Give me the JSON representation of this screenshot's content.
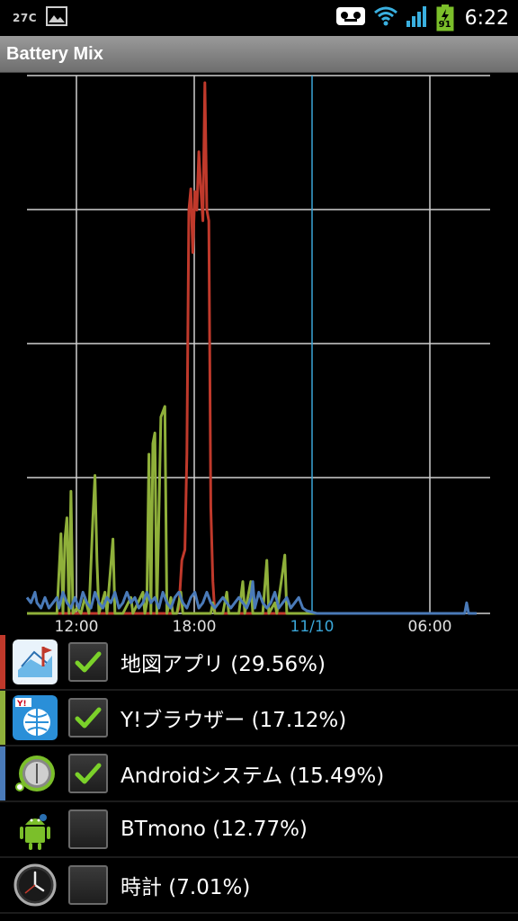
{
  "status_bar": {
    "temperature": "27C",
    "time": "6:22",
    "battery_level": "91",
    "icons": [
      "image-icon",
      "voicemail-icon",
      "wifi-icon",
      "signal-icon",
      "battery-icon"
    ]
  },
  "app_title": "Battery Mix",
  "chart_data": {
    "type": "line",
    "x_tick_labels": [
      "12:00",
      "18:00",
      "11/10",
      "06:00"
    ],
    "highlighted_tick": "11/10",
    "grid": true,
    "series": [
      {
        "name": "地図アプリ",
        "color": "#c0392b",
        "values": [
          [
            0,
            0
          ],
          [
            150,
            0
          ],
          [
            152,
            10
          ],
          [
            155,
            100
          ],
          [
            158,
            120
          ],
          [
            160,
            300
          ],
          [
            162,
            760
          ],
          [
            164,
            800
          ],
          [
            166,
            680
          ],
          [
            168,
            795
          ],
          [
            170,
            760
          ],
          [
            172,
            870
          ],
          [
            174,
            800
          ],
          [
            176,
            740
          ],
          [
            178,
            1000
          ],
          [
            180,
            760
          ],
          [
            182,
            740
          ],
          [
            184,
            200
          ],
          [
            186,
            60
          ],
          [
            188,
            0
          ],
          [
            290,
            0
          ]
        ]
      },
      {
        "name": "Y!ブラウザー",
        "color": "#8fb03a",
        "values": [
          [
            0,
            0
          ],
          [
            30,
            0
          ],
          [
            34,
            150
          ],
          [
            36,
            0
          ],
          [
            38,
            140
          ],
          [
            40,
            180
          ],
          [
            42,
            0
          ],
          [
            44,
            230
          ],
          [
            46,
            0
          ],
          [
            50,
            10
          ],
          [
            54,
            0
          ],
          [
            58,
            30
          ],
          [
            62,
            0
          ],
          [
            66,
            180
          ],
          [
            68,
            260
          ],
          [
            70,
            100
          ],
          [
            72,
            0
          ],
          [
            78,
            40
          ],
          [
            80,
            0
          ],
          [
            86,
            140
          ],
          [
            88,
            0
          ],
          [
            96,
            0
          ],
          [
            104,
            30
          ],
          [
            106,
            0
          ],
          [
            116,
            40
          ],
          [
            118,
            0
          ],
          [
            120,
            20
          ],
          [
            122,
            300
          ],
          [
            124,
            0
          ],
          [
            126,
            320
          ],
          [
            128,
            340
          ],
          [
            130,
            0
          ],
          [
            134,
            370
          ],
          [
            136,
            380
          ],
          [
            138,
            390
          ],
          [
            140,
            0
          ],
          [
            144,
            30
          ],
          [
            146,
            0
          ],
          [
            150,
            0
          ],
          [
            154,
            40
          ],
          [
            156,
            0
          ],
          [
            184,
            0
          ],
          [
            186,
            20
          ],
          [
            188,
            0
          ],
          [
            196,
            0
          ],
          [
            200,
            40
          ],
          [
            202,
            0
          ],
          [
            212,
            0
          ],
          [
            216,
            60
          ],
          [
            218,
            0
          ],
          [
            224,
            60
          ],
          [
            226,
            0
          ],
          [
            236,
            0
          ],
          [
            240,
            100
          ],
          [
            242,
            0
          ],
          [
            248,
            20
          ],
          [
            250,
            0
          ],
          [
            256,
            80
          ],
          [
            258,
            110
          ],
          [
            260,
            0
          ],
          [
            270,
            0
          ],
          [
            290,
            0
          ]
        ]
      },
      {
        "name": "Androidシステム",
        "color": "#4a7ab8",
        "values": [
          [
            0,
            30
          ],
          [
            4,
            20
          ],
          [
            8,
            40
          ],
          [
            10,
            20
          ],
          [
            14,
            10
          ],
          [
            18,
            30
          ],
          [
            22,
            10
          ],
          [
            26,
            20
          ],
          [
            30,
            30
          ],
          [
            32,
            10
          ],
          [
            36,
            40
          ],
          [
            40,
            20
          ],
          [
            44,
            10
          ],
          [
            48,
            30
          ],
          [
            52,
            10
          ],
          [
            56,
            40
          ],
          [
            60,
            20
          ],
          [
            64,
            10
          ],
          [
            68,
            40
          ],
          [
            72,
            20
          ],
          [
            76,
            10
          ],
          [
            80,
            30
          ],
          [
            84,
            20
          ],
          [
            88,
            40
          ],
          [
            92,
            10
          ],
          [
            96,
            20
          ],
          [
            100,
            40
          ],
          [
            104,
            20
          ],
          [
            108,
            30
          ],
          [
            112,
            10
          ],
          [
            116,
            20
          ],
          [
            120,
            40
          ],
          [
            124,
            20
          ],
          [
            128,
            30
          ],
          [
            132,
            10
          ],
          [
            136,
            40
          ],
          [
            140,
            20
          ],
          [
            144,
            10
          ],
          [
            148,
            30
          ],
          [
            152,
            40
          ],
          [
            156,
            20
          ],
          [
            160,
            10
          ],
          [
            164,
            30
          ],
          [
            168,
            40
          ],
          [
            172,
            10
          ],
          [
            176,
            20
          ],
          [
            180,
            40
          ],
          [
            184,
            20
          ],
          [
            188,
            10
          ],
          [
            192,
            20
          ],
          [
            196,
            30
          ],
          [
            200,
            20
          ],
          [
            204,
            10
          ],
          [
            208,
            20
          ],
          [
            212,
            30
          ],
          [
            216,
            20
          ],
          [
            220,
            10
          ],
          [
            224,
            30
          ],
          [
            226,
            60
          ],
          [
            228,
            10
          ],
          [
            232,
            40
          ],
          [
            236,
            20
          ],
          [
            240,
            10
          ],
          [
            244,
            20
          ],
          [
            248,
            40
          ],
          [
            252,
            10
          ],
          [
            256,
            20
          ],
          [
            260,
            30
          ],
          [
            264,
            10
          ],
          [
            268,
            20
          ],
          [
            272,
            30
          ],
          [
            276,
            10
          ],
          [
            280,
            5
          ],
          [
            290,
            0
          ],
          [
            300,
            0
          ],
          [
            430,
            0
          ],
          [
            438,
            0
          ],
          [
            440,
            20
          ],
          [
            442,
            0
          ],
          [
            450,
            0
          ]
        ]
      }
    ]
  },
  "app_list": [
    {
      "label": "地図アプリ (29.56%)",
      "color": "#c0392b",
      "checked": true,
      "icon": "map-app-icon"
    },
    {
      "label": "Y!ブラウザー (17.12%)",
      "color": "#8fb03a",
      "checked": true,
      "icon": "yahoo-browser-icon"
    },
    {
      "label": "Androidシステム (15.49%)",
      "color": "#4a7ab8",
      "checked": true,
      "icon": "android-system-icon"
    },
    {
      "label": "BTmono (12.77%)",
      "color": "",
      "checked": false,
      "icon": "android-robot-icon"
    },
    {
      "label": "時計 (7.01%)",
      "color": "",
      "checked": false,
      "icon": "clock-icon"
    }
  ]
}
